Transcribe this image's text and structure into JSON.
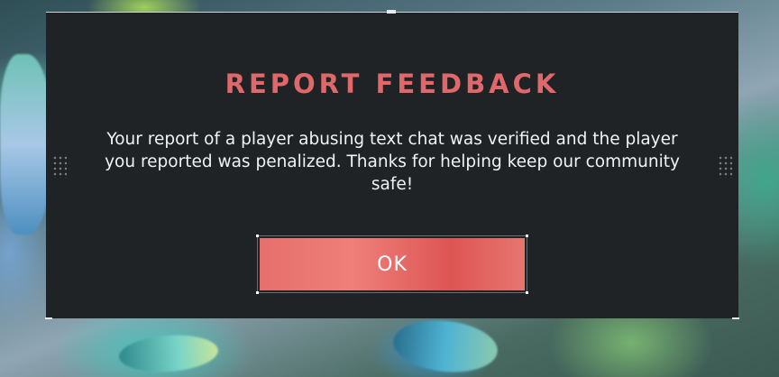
{
  "dialog": {
    "title": "REPORT FEEDBACK",
    "message": "Your report of a player abusing text chat was verified and the player you reported was penalized. Thanks for helping keep our community safe!",
    "ok_label": "OK"
  },
  "colors": {
    "dialog_background": "#202326",
    "title_color": "#e0686a",
    "button_accent": "#e56f6c",
    "text_color": "#f1f2f3"
  }
}
